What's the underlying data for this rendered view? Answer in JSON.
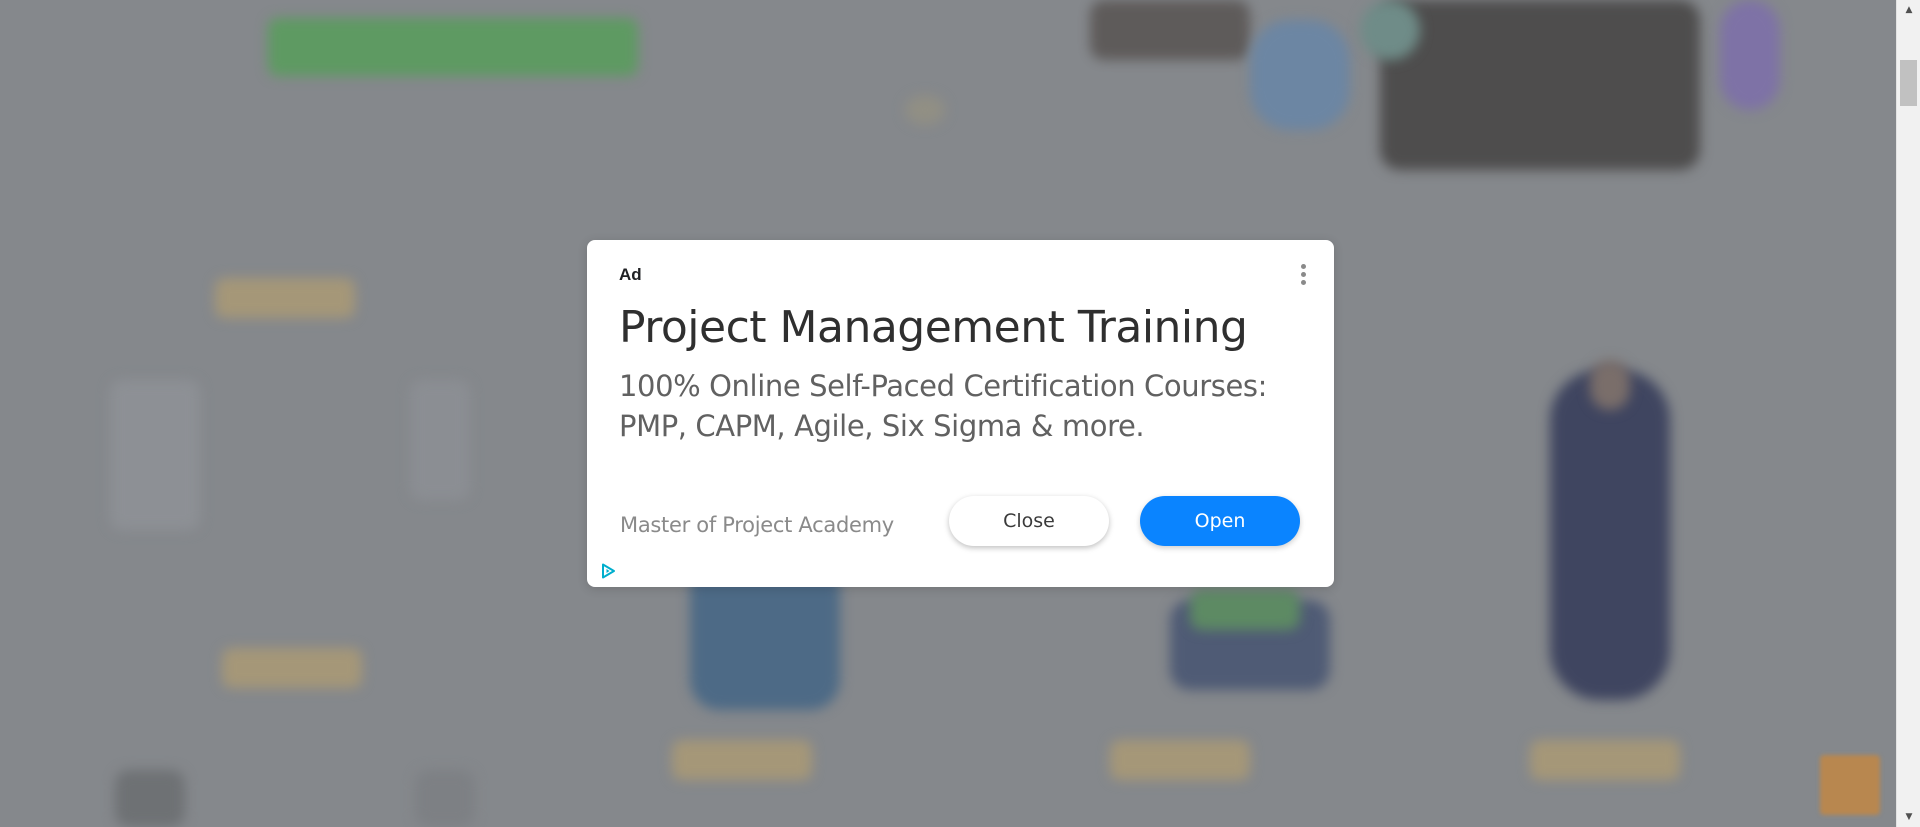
{
  "ad": {
    "label": "Ad",
    "title": "Project Management Training",
    "description": "100% Online Self-Paced Certification Courses: PMP, CAPM, Agile, Six Sigma & more.",
    "advertiser": "Master of Project Academy",
    "close_label": "Close",
    "open_label": "Open",
    "menu_icon": "more-vert-icon",
    "adchoices_icon": "adchoices-icon"
  },
  "scrollbar": {
    "up_arrow": "▲",
    "down_arrow": "▼"
  },
  "colors": {
    "overlay": "#878a8e",
    "open_button": "#0a84ff",
    "adchoices": "#00aecd"
  }
}
